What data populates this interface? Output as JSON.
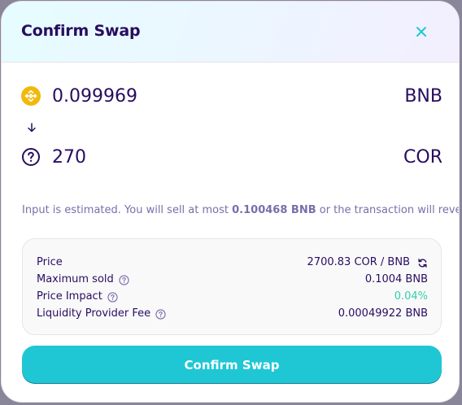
{
  "header": {
    "title": "Confirm Swap",
    "close_icon": "close-icon"
  },
  "input_token": {
    "icon": "bnb-icon",
    "amount": "0.099969",
    "symbol": "BNB"
  },
  "direction_icon": "arrow-down-icon",
  "output_token": {
    "icon": "unknown-token-icon",
    "amount": "270",
    "symbol": "COR"
  },
  "note": {
    "prefix": "Input is estimated. You will sell at most ",
    "amount": "0.100468 BNB",
    "suffix": " or the transaction will revert."
  },
  "details": {
    "price_label": "Price",
    "price_value": "2700.83 COR / BNB",
    "max_sold_label": "Maximum sold",
    "max_sold_value": "0.1004 BNB",
    "price_impact_label": "Price Impact",
    "price_impact_value": "0.04%",
    "lp_fee_label": "Liquidity Provider Fee",
    "lp_fee_value": "0.00049922 BNB"
  },
  "confirm_button": "Confirm Swap",
  "colors": {
    "primary": "#1fc7d4",
    "text": "#280d5f",
    "secondary_text": "#7a6eaa",
    "success": "#31d0aa",
    "bnb": "#f0b90b"
  }
}
